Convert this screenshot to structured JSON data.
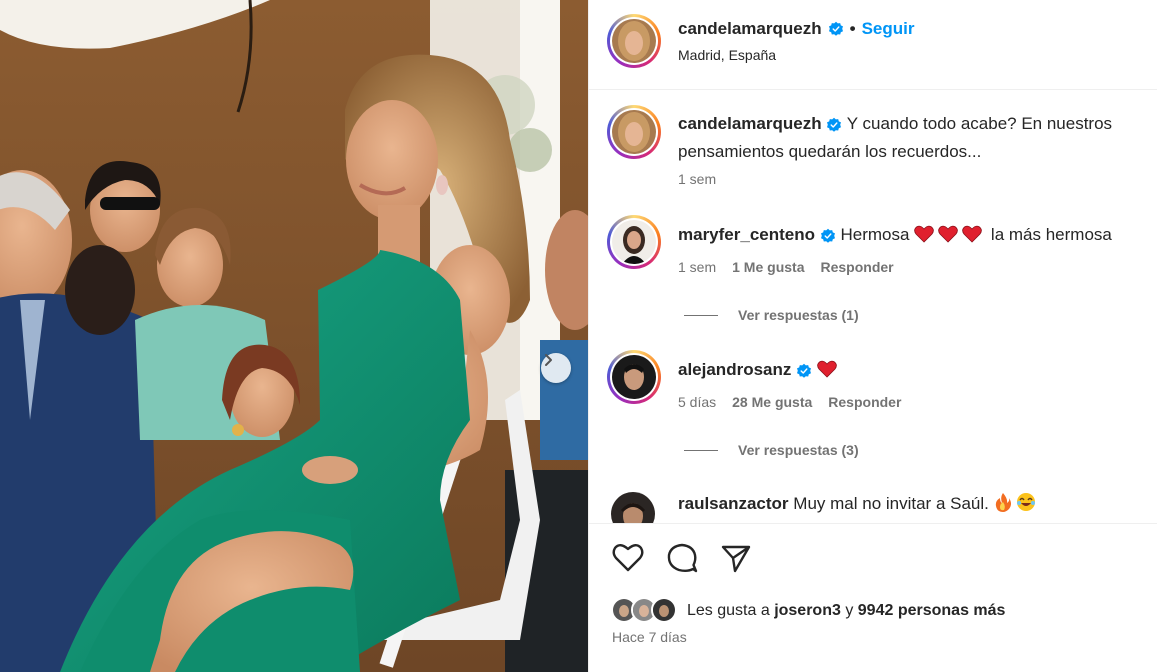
{
  "post": {
    "author": "candelamarquezh",
    "follow_label": "Seguir",
    "separator": "•",
    "location": "Madrid, España",
    "caption_line1": "Y cuando todo acabe? En nuestros",
    "caption_line2": "pensamientos quedarán los recuerdos...",
    "caption_age": "1 sem"
  },
  "comments": [
    {
      "user": "maryfer_centeno",
      "text_before": "Hermosa",
      "emoji": "heart-emoji x3",
      "text_after": "la más hermosa",
      "age": "1 sem",
      "likes": "1 Me gusta",
      "reply_label": "Responder",
      "view_replies": "Ver respuestas (1)"
    },
    {
      "user": "alejandrosanz",
      "emoji": "heart-emoji",
      "age": "5 días",
      "likes": "28 Me gusta",
      "reply_label": "Responder",
      "view_replies": "Ver respuestas (3)"
    },
    {
      "user": "raulsanzactor",
      "text": "Muy mal no invitar a Saúl.",
      "emoji": "fire-emoji laughing-emoji"
    }
  ],
  "footer": {
    "likes_prefix": "Les gusta a",
    "likes_user": "joseron3",
    "likes_and": "y",
    "likes_count": "9942 personas más",
    "time": "Hace 7 días"
  },
  "colors": {
    "accent": "#0095f6",
    "verified": "#0095f6",
    "secondary_text": "#737373",
    "dress": "#11906f"
  }
}
